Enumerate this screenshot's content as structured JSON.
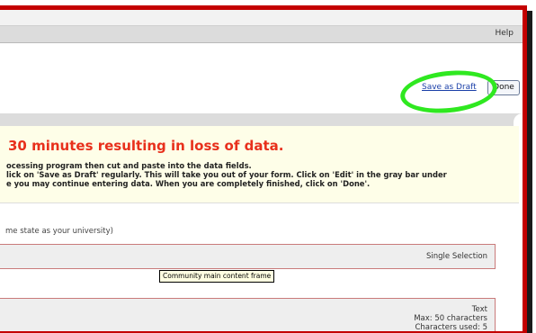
{
  "menu": {
    "help_label": "Help"
  },
  "actions": {
    "save_draft_label": "Save as Draft",
    "done_label": "Done"
  },
  "warning": {
    "title": "30 minutes resulting in loss of data.",
    "lines": [
      "ocessing program then cut and paste into the data fields.",
      "lick on 'Save as Draft' regularly. This will take you out of your form. Click on 'Edit' in the gray bar under",
      "e you may continue entering data. When you are completely finished, click on 'Done'."
    ]
  },
  "fields": {
    "note": "me state as your university)",
    "field1": {
      "type_label": "Single Selection"
    },
    "field2": {
      "type_label": "Text",
      "max_chars": "Max: 50 characters",
      "chars_used": "Characters used: 5"
    }
  },
  "tooltip": {
    "text": "Community main content frame"
  },
  "colors": {
    "frame": "#c40000",
    "warning_title": "#e8301c",
    "highlight_ring": "#2fe820",
    "link": "#1a3fa8"
  }
}
